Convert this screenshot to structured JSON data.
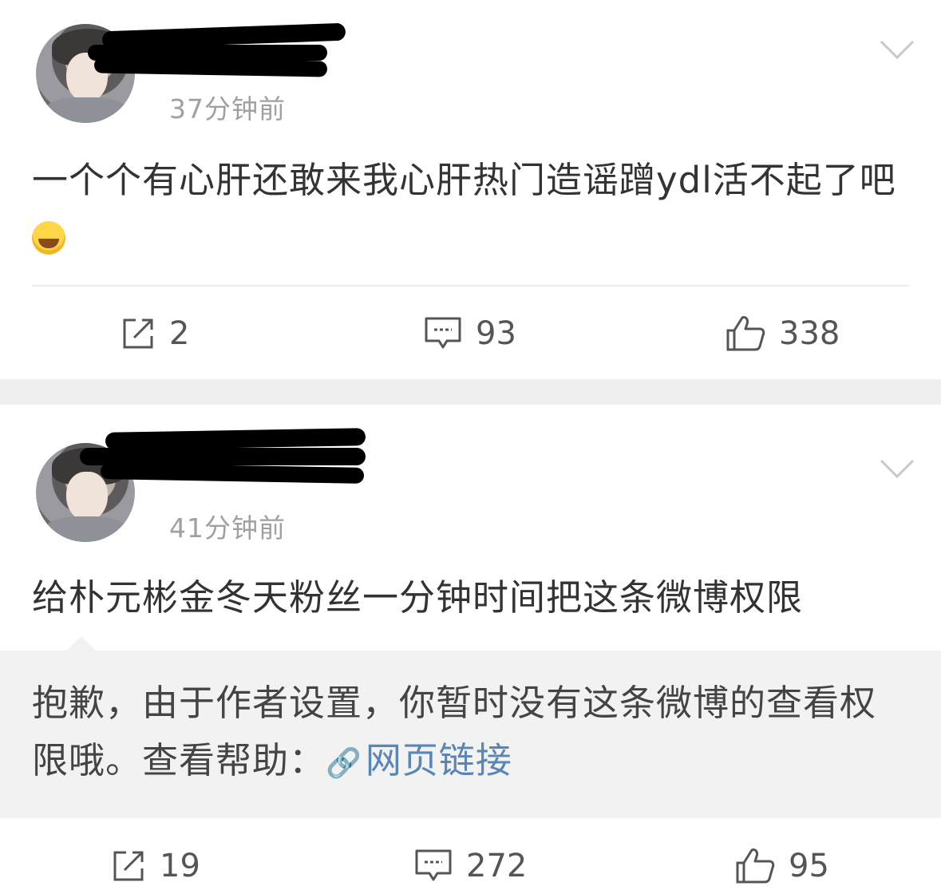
{
  "posts": [
    {
      "time": "37分钟前",
      "text": "一个个有心肝还敢来我心肝热门造谣蹭ydl活不起了吧",
      "emoji_icon": "laughing-tears-icon",
      "actions": {
        "repost": "2",
        "comment": "93",
        "like": "338"
      }
    },
    {
      "time": "41分钟前",
      "text": "给朴元彬金冬天粉丝一分钟时间把这条微博权限",
      "restricted_notice": "抱歉，由于作者设置，你暂时没有这条微博的查看权限哦。查看帮助：",
      "link_icon": "link-icon",
      "link_text": "网页链接",
      "actions": {
        "repost": "19",
        "comment": "272",
        "like": "95"
      }
    }
  ],
  "icons": {
    "repost": "repost-icon",
    "comment": "comment-icon",
    "like": "thumbs-up-icon",
    "menu": "chevron-down-icon"
  }
}
